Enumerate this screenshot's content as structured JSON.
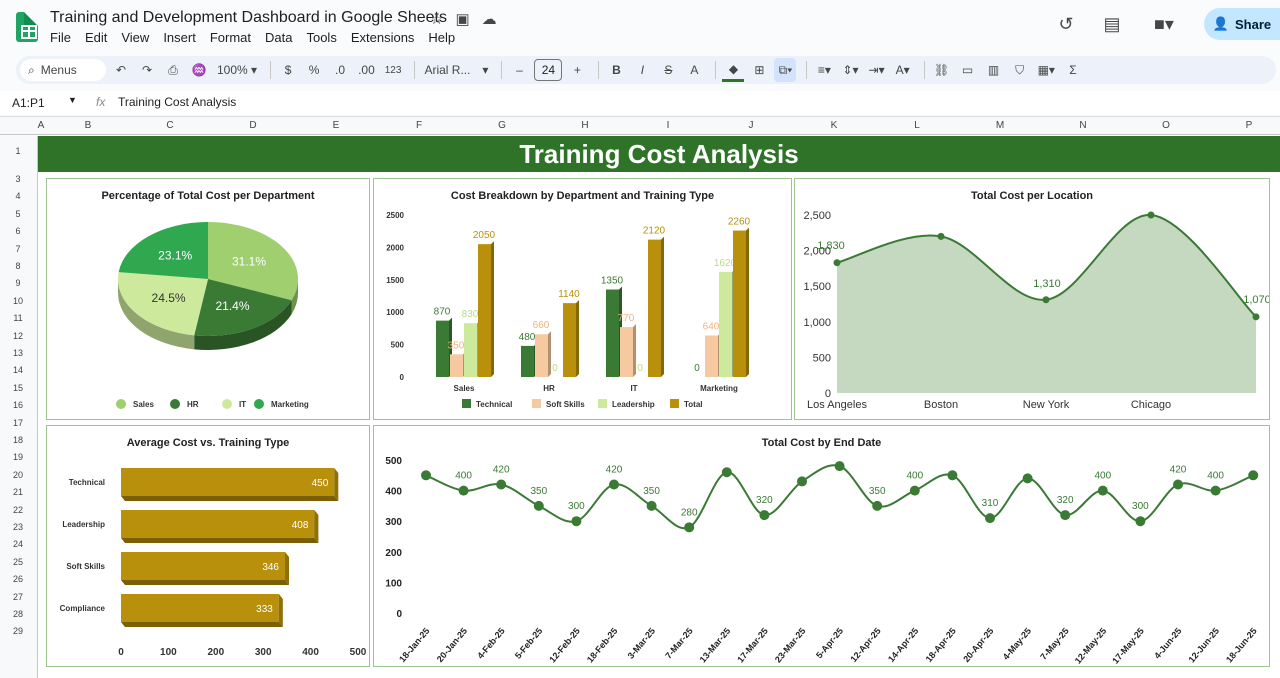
{
  "app": {
    "doc_title": "Training and Development Dashboard in Google Sheets",
    "menu": [
      "File",
      "Edit",
      "View",
      "Insert",
      "Format",
      "Data",
      "Tools",
      "Extensions",
      "Help"
    ],
    "share_label": "Share"
  },
  "toolbar": {
    "menus_label": "Menus",
    "zoom": "100%",
    "currency": "$",
    "percent": "%",
    "dec_decrease": ".0",
    "dec_increase": ".00",
    "number_format": "123",
    "font": "Arial R...",
    "font_size": "24",
    "minus": "–",
    "plus": "+"
  },
  "formula_bar": {
    "name_box": "A1:P1",
    "fx": "fx",
    "value": "Training Cost Analysis"
  },
  "columns": [
    "A",
    "B",
    "C",
    "D",
    "E",
    "F",
    "G",
    "H",
    "I",
    "J",
    "K",
    "L",
    "M",
    "N",
    "O",
    "P"
  ],
  "rows": [
    "1",
    "3",
    "4",
    "5",
    "6",
    "7",
    "8",
    "9",
    "10",
    "11",
    "12",
    "13",
    "14",
    "15",
    "16",
    "17",
    "18",
    "19",
    "20",
    "21",
    "22",
    "23",
    "24",
    "25",
    "26",
    "27",
    "28",
    "29"
  ],
  "banner": "Training Cost Analysis",
  "colors": {
    "dark_green": "#3a7a35",
    "green": "#2fa84f",
    "light_green": "#9fcf7a",
    "pale_green": "#cdea9c",
    "peach": "#f7c9a0",
    "gold": "#b8900b",
    "area_fill": "#c5d8c0"
  },
  "charts": {
    "pie": {
      "title": "Percentage of Total Cost per Department",
      "chart_data": {
        "type": "pie",
        "slices": [
          {
            "name": "Sales",
            "value": 31.1,
            "label": "31.1%",
            "color": "#9fcf6e"
          },
          {
            "name": "HR",
            "value": 21.4,
            "label": "21.4%",
            "color": "#3a7a35"
          },
          {
            "name": "IT",
            "value": 24.5,
            "label": "24.5%",
            "color": "#cdea9c"
          },
          {
            "name": "Marketing",
            "value": 23.1,
            "label": "23.1%",
            "color": "#2fa84f"
          }
        ]
      }
    },
    "cost_breakdown": {
      "title": "Cost Breakdown by Department and Training Type",
      "chart_data": {
        "type": "bar",
        "categories": [
          "Sales",
          "HR",
          "IT",
          "Marketing"
        ],
        "series": [
          {
            "name": "Technical",
            "values": [
              870,
              480,
              1350,
              0
            ],
            "color": "#3a7a35"
          },
          {
            "name": "Soft Skills",
            "values": [
              350,
              660,
              770,
              640
            ],
            "color": "#f7c9a0"
          },
          {
            "name": "Leadership",
            "values": [
              830,
              0,
              0,
              1620
            ],
            "color": "#cdea9c"
          },
          {
            "name": "Total",
            "values": [
              2050,
              1140,
              2120,
              2260
            ],
            "color": "#b8900b"
          }
        ],
        "yticks": [
          "0",
          "500",
          "1000",
          "1500",
          "2000",
          "2500"
        ],
        "ylim": [
          0,
          2500
        ]
      }
    },
    "location": {
      "title": "Total Cost per Location",
      "chart_data": {
        "type": "area",
        "categories": [
          "Los Angeles",
          "Boston",
          "New York",
          "Chicago"
        ],
        "values": [
          1830,
          2200,
          1310,
          2500
        ],
        "end_value": 1070,
        "labels": [
          "1,830",
          "1,310",
          "1,070"
        ],
        "yticks": [
          "0",
          "500",
          "1,000",
          "1,500",
          "2,000",
          "2,500"
        ],
        "ylim": [
          0,
          2500
        ]
      }
    },
    "avg_cost": {
      "title": "Average Cost vs. Training Type",
      "chart_data": {
        "type": "bar",
        "orientation": "horizontal",
        "categories": [
          "Technical",
          "Leadership",
          "Soft Skills",
          "Compliance"
        ],
        "values": [
          450,
          408,
          346,
          333
        ],
        "xticks": [
          "0",
          "100",
          "200",
          "300",
          "400",
          "500"
        ],
        "xlim": [
          0,
          500
        ]
      }
    },
    "end_date": {
      "title": "Total Cost by End Date",
      "chart_data": {
        "type": "line",
        "x": [
          "18-Jan-25",
          "20-Jan-25",
          "4-Feb-25",
          "5-Feb-25",
          "12-Feb-25",
          "18-Feb-25",
          "3-Mar-25",
          "7-Mar-25",
          "13-Mar-25",
          "17-Mar-25",
          "23-Mar-25",
          "5-Apr-25",
          "12-Apr-25",
          "14-Apr-25",
          "18-Apr-25",
          "20-Apr-25",
          "4-May-25",
          "7-May-25",
          "12-May-25",
          "17-May-25",
          "4-Jun-25",
          "12-Jun-25",
          "18-Jun-25"
        ],
        "values": [
          450,
          400,
          420,
          350,
          300,
          420,
          350,
          280,
          460,
          320,
          430,
          480,
          350,
          400,
          450,
          310,
          440,
          320,
          400,
          300,
          420,
          400,
          450
        ],
        "labels": [
          "",
          "400",
          "420",
          "350",
          "300",
          "420",
          "350",
          "280",
          "",
          "320",
          "",
          "",
          "350",
          "400",
          "",
          "310",
          "",
          "320",
          "400",
          "300",
          "420",
          "400",
          ""
        ],
        "yticks": [
          "0",
          "100",
          "200",
          "300",
          "400",
          "500"
        ],
        "ylim": [
          0,
          500
        ]
      }
    }
  }
}
